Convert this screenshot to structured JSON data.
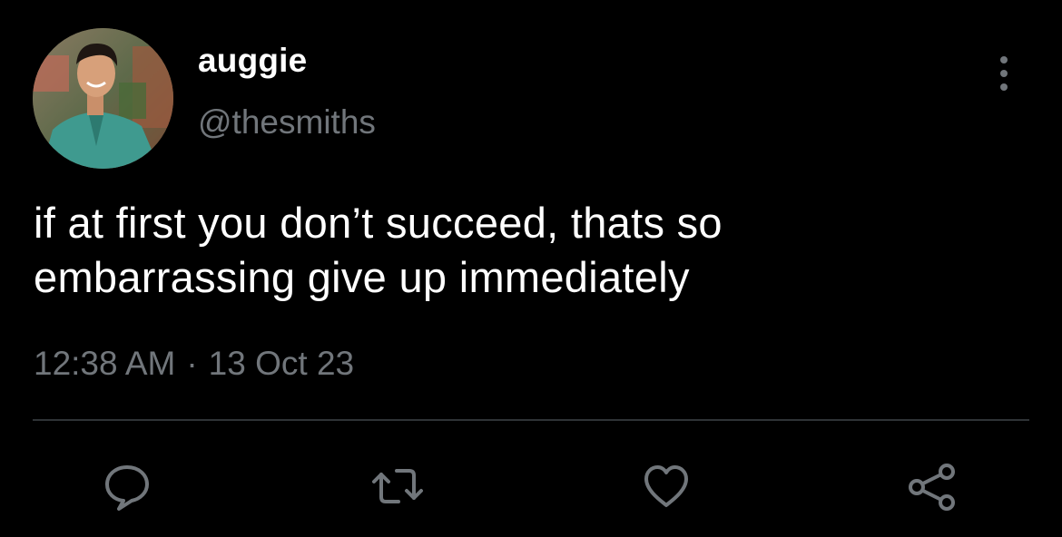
{
  "tweet": {
    "author": {
      "display_name": "auggie",
      "handle": "@thesmiths"
    },
    "text": "if at first you don’t succeed, thats so\nembarrassing give up immediately",
    "time": "12:38 AM",
    "separator": "·",
    "date": "13 Oct 23"
  },
  "actions": [
    {
      "name": "reply",
      "icon": "speech-bubble-icon"
    },
    {
      "name": "retweet",
      "icon": "retweet-icon"
    },
    {
      "name": "like",
      "icon": "heart-icon"
    },
    {
      "name": "share",
      "icon": "share-icon"
    }
  ],
  "colors": {
    "background": "#000000",
    "text_primary": "#ffffff",
    "text_secondary": "#71767b",
    "divider": "#2f3336"
  }
}
